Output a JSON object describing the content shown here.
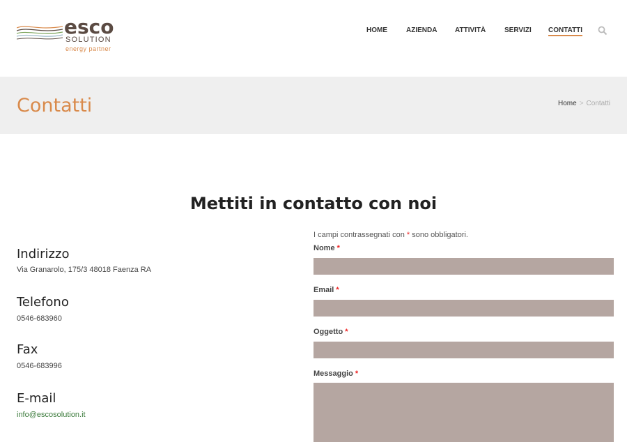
{
  "header": {
    "logo": {
      "name": "esco",
      "sub": "SOLUTION",
      "tagline": "energy partner"
    },
    "nav": [
      "HOME",
      "AZIENDA",
      "ATTIVITÀ",
      "SERVIZI",
      "CONTATTI"
    ],
    "active_nav": "CONTATTI",
    "search_icon": "search-icon"
  },
  "title_bar": {
    "title": "Contatti",
    "breadcrumb": {
      "home": "Home",
      "separator": ">",
      "current": "Contatti"
    }
  },
  "main": {
    "heading": "Mettiti in contatto con noi",
    "contacts": [
      {
        "label": "Indirizzo",
        "value": "Via Granarolo, 175/3 48018 Faenza RA"
      },
      {
        "label": "Telefono",
        "value": "0546-683960"
      },
      {
        "label": "Fax",
        "value": "0546-683996"
      },
      {
        "label": "E-mail",
        "value": "info@escosolution.it"
      }
    ],
    "form": {
      "note_pre": "I campi contrassegnati con",
      "note_star": "*",
      "note_post": "sono obbligatori.",
      "fields": [
        {
          "label": "Nome",
          "required": "*"
        },
        {
          "label": "Email",
          "required": "*"
        },
        {
          "label": "Oggetto",
          "required": "*"
        },
        {
          "label": "Messaggio",
          "required": "*"
        }
      ]
    }
  },
  "colors": {
    "accent": "#d98a4b",
    "brand_dark": "#5b4b43",
    "field_bg": "#b5a6a1",
    "required": "#e22222",
    "link_green": "#3a7a3a",
    "title_bar_bg": "#efefef"
  }
}
